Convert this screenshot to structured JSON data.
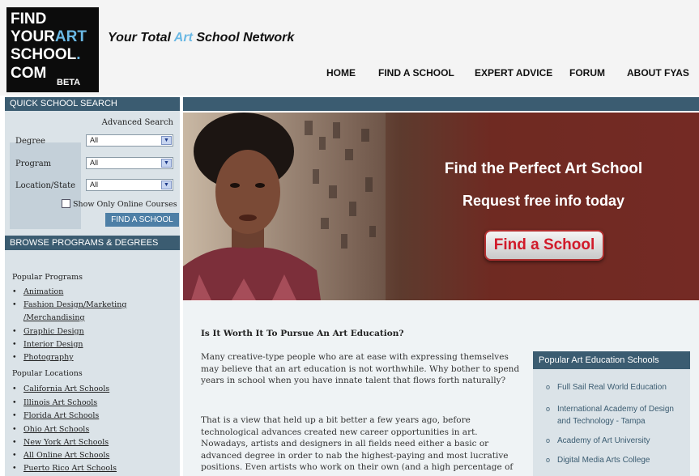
{
  "logo": {
    "line1": "FIND",
    "line2_a": "YOUR",
    "line2_b": "ART",
    "line3_a": "SCHOOL",
    "line3_b": ".",
    "line4": "COM",
    "beta": "BETA"
  },
  "tagline": {
    "a": "Your Total ",
    "b": "Art",
    "c": " School Network"
  },
  "nav": [
    "HOME",
    "FIND A SCHOOL",
    "EXPERT ADVICE",
    "FORUM",
    "ABOUT FYAS"
  ],
  "quick_search": {
    "header": "QUICK SCHOOL SEARCH",
    "advanced": "Advanced Search",
    "fields": [
      {
        "label": "Degree",
        "value": "All"
      },
      {
        "label": "Program",
        "value": "All"
      },
      {
        "label": "Location/State",
        "value": "All"
      }
    ],
    "online_label": "Show Only Online Courses",
    "button": "FIND A SCHOOL"
  },
  "browse": {
    "header": "BROWSE PROGRAMS & DEGREES",
    "programs_title": "Popular Programs",
    "programs": [
      "Animation",
      "Fashion Design/Marketing",
      "/Merchandising",
      "Graphic Design",
      "Interior Design",
      "Photography"
    ],
    "locations_title": "Popular Locations",
    "locations": [
      "California Art Schools",
      "Illinois Art Schools",
      "Florida Art Schools",
      "Ohio Art Schools",
      "New York Art Schools",
      "All Online Art Schools",
      "Puerto Rico Art Schools"
    ]
  },
  "hero": {
    "headline": "Find the Perfect Art School",
    "subhead": "Request free info today",
    "button": "Find a School"
  },
  "article": {
    "title": "Is It Worth It To Pursue An Art Education?",
    "p1": "Many creative-type people who are at ease with expressing themselves may believe that an art education is not worthwhile. Why bother to spend years in school when you have innate talent that flows forth naturally?",
    "p2": "That is a view that held up a bit better a few years ago, before technological advances created new career opportunities in art. Nowadays, artists and designers in all fields need either a basic or advanced degree in order to nab the highest-paying and most lucrative positions. Even artists who work on their own (and a high percentage of"
  },
  "popular": {
    "header": "Popular Art Education Schools",
    "items": [
      "Full Sail Real World Education",
      "International Academy of Design and Technology - Tampa",
      "Academy of Art University",
      "Digital Media Arts College"
    ]
  }
}
